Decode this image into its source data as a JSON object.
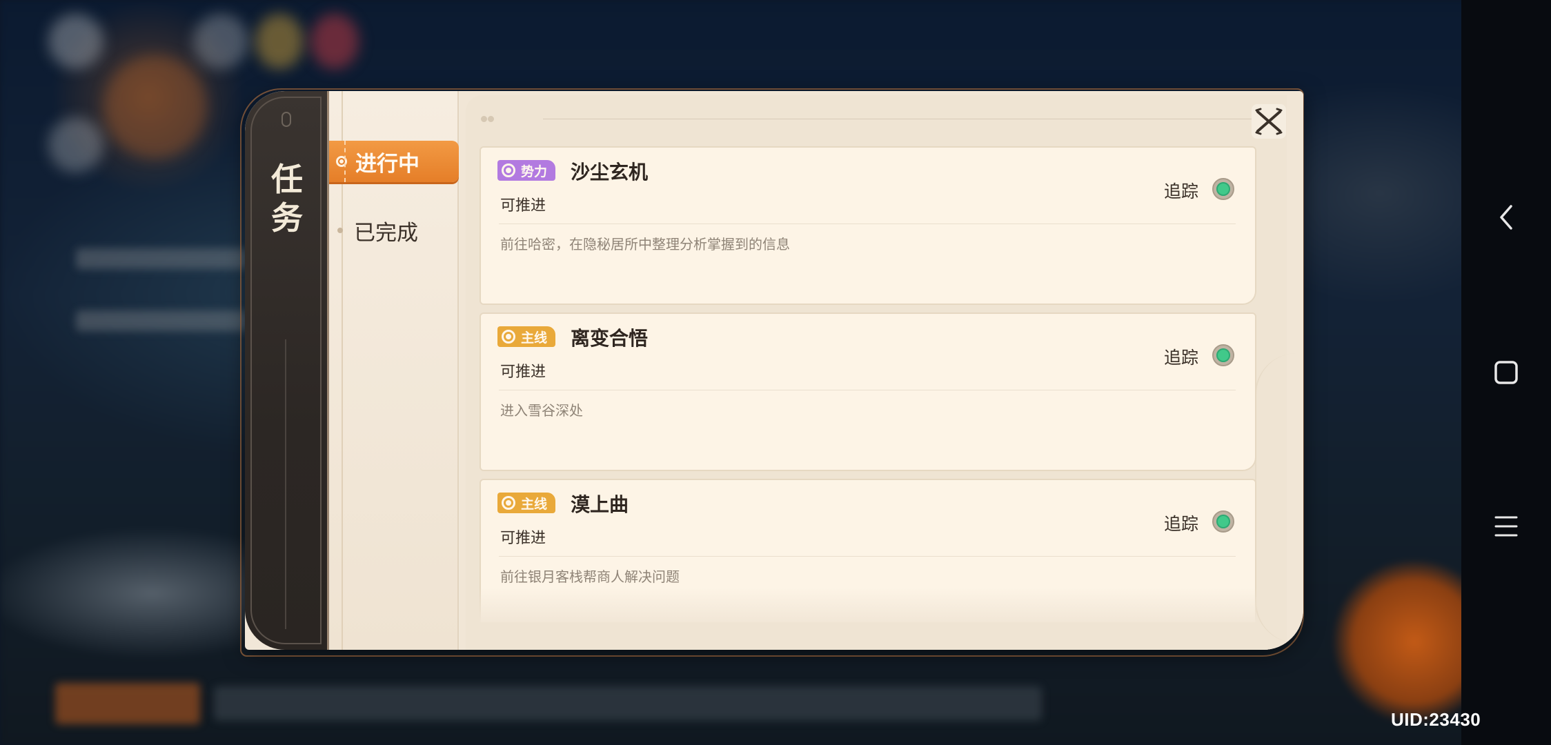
{
  "dialog": {
    "title": "任\n务",
    "tabs": [
      {
        "label": "进行中",
        "active": true
      },
      {
        "label": "已完成",
        "active": false
      }
    ],
    "quests": [
      {
        "tag": "势力",
        "tag_color": "#b27ae0",
        "title": "沙尘玄机",
        "status": "可推进",
        "description": "前往哈密，在隐秘居所中整理分析掌握到的信息",
        "track_label": "追踪",
        "tracking": true
      },
      {
        "tag": "主线",
        "tag_color": "#e9a93a",
        "title": "离变合悟",
        "status": "可推进",
        "description": "进入雪谷深处",
        "track_label": "追踪",
        "tracking": true
      },
      {
        "tag": "主线",
        "tag_color": "#e9a93a",
        "title": "漠上曲",
        "status": "可推进",
        "description": "前往银月客栈帮商人解决问题",
        "track_label": "追踪",
        "tracking": true
      }
    ]
  },
  "footer": {
    "uid": "UID:23430"
  },
  "system_nav": {
    "back_icon": "chevron-left-icon",
    "home_icon": "square-icon",
    "menu_icon": "hamburger-icon"
  },
  "colors": {
    "accent_orange": "#e9832d",
    "panel_bg": "#f1e7d8",
    "spine_dark": "#2c2724",
    "track_green": "#41c98a"
  }
}
